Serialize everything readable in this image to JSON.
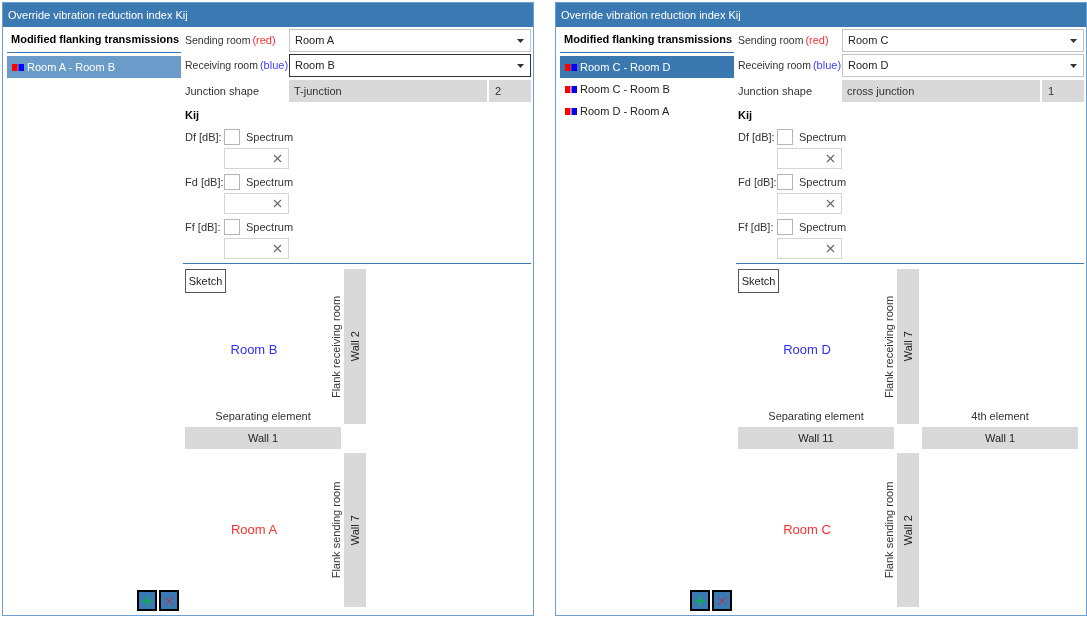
{
  "windows": [
    {
      "title": "Override vibration reduction index Kij",
      "transmissions": {
        "header": "Modified flanking transmissions",
        "focused": false,
        "items": [
          {
            "label": "Room A - Room B",
            "selected": true
          }
        ]
      },
      "rooms": [
        {
          "label": "Sending room",
          "hint": "(red)",
          "color": "#ff2e2e",
          "value": "Room A",
          "focused": false
        },
        {
          "label": "Receiving room",
          "hint": "(blue)",
          "color": "#4040ff",
          "value": "Room B",
          "focused": true
        }
      ],
      "junction_shape": {
        "label": "Junction shape",
        "value": "T-junction",
        "count": "2"
      },
      "kij": {
        "title": "Kij",
        "rows": [
          {
            "label": "Df [dB]:",
            "option": "Spectrum",
            "checked": false
          },
          {
            "label": "Fd [dB]:",
            "option": "Spectrum",
            "checked": false
          },
          {
            "label": "Ff [dB]:",
            "option": "Spectrum",
            "checked": false
          }
        ]
      },
      "sketch": {
        "button": "Sketch",
        "rooms": [
          {
            "kind": "receiving",
            "name": "Room B",
            "color": "#2e2eff"
          },
          {
            "kind": "sending",
            "name": "Room A",
            "color": "#ff2e2e"
          }
        ],
        "elements": [
          {
            "kind": "flank_receiving",
            "label": "Flank receiving room",
            "wall": "Wall 2"
          },
          {
            "kind": "separating",
            "label": "Separating element",
            "wall": "Wall 1"
          },
          {
            "kind": "flank_sending",
            "label": "Flank sending room",
            "wall": "Wall 7"
          }
        ]
      }
    },
    {
      "title": "Override vibration reduction index Kij",
      "transmissions": {
        "header": "Modified flanking transmissions",
        "focused": true,
        "items": [
          {
            "label": "Room C - Room D",
            "selected": true
          },
          {
            "label": "Room C - Room B",
            "selected": false
          },
          {
            "label": "Room D - Room A",
            "selected": false
          }
        ]
      },
      "rooms": [
        {
          "label": "Sending room",
          "hint": "(red)",
          "color": "#ff2e2e",
          "value": "Room C",
          "focused": false
        },
        {
          "label": "Receiving room",
          "hint": "(blue)",
          "color": "#4040ff",
          "value": "Room D",
          "focused": false
        }
      ],
      "junction_shape": {
        "label": "Junction shape",
        "value": "cross junction",
        "count": "1"
      },
      "kij": {
        "title": "Kij",
        "rows": [
          {
            "label": "Df [dB]:",
            "option": "Spectrum",
            "checked": false
          },
          {
            "label": "Fd [dB]:",
            "option": "Spectrum",
            "checked": false
          },
          {
            "label": "Ff [dB]:",
            "option": "Spectrum",
            "checked": false
          }
        ]
      },
      "sketch": {
        "button": "Sketch",
        "rooms": [
          {
            "kind": "receiving",
            "name": "Room D",
            "color": "#2e2eff"
          },
          {
            "kind": "sending",
            "name": "Room C",
            "color": "#ff2e2e"
          }
        ],
        "elements": [
          {
            "kind": "flank_receiving",
            "label": "Flank receiving room",
            "wall": "Wall 7"
          },
          {
            "kind": "separating",
            "label": "Separating element",
            "wall": "Wall 11"
          },
          {
            "kind": "fourth",
            "label": "4th element",
            "wall": "Wall 1"
          },
          {
            "kind": "flank_sending",
            "label": "Flank sending room",
            "wall": "Wall 2"
          }
        ]
      }
    }
  ]
}
